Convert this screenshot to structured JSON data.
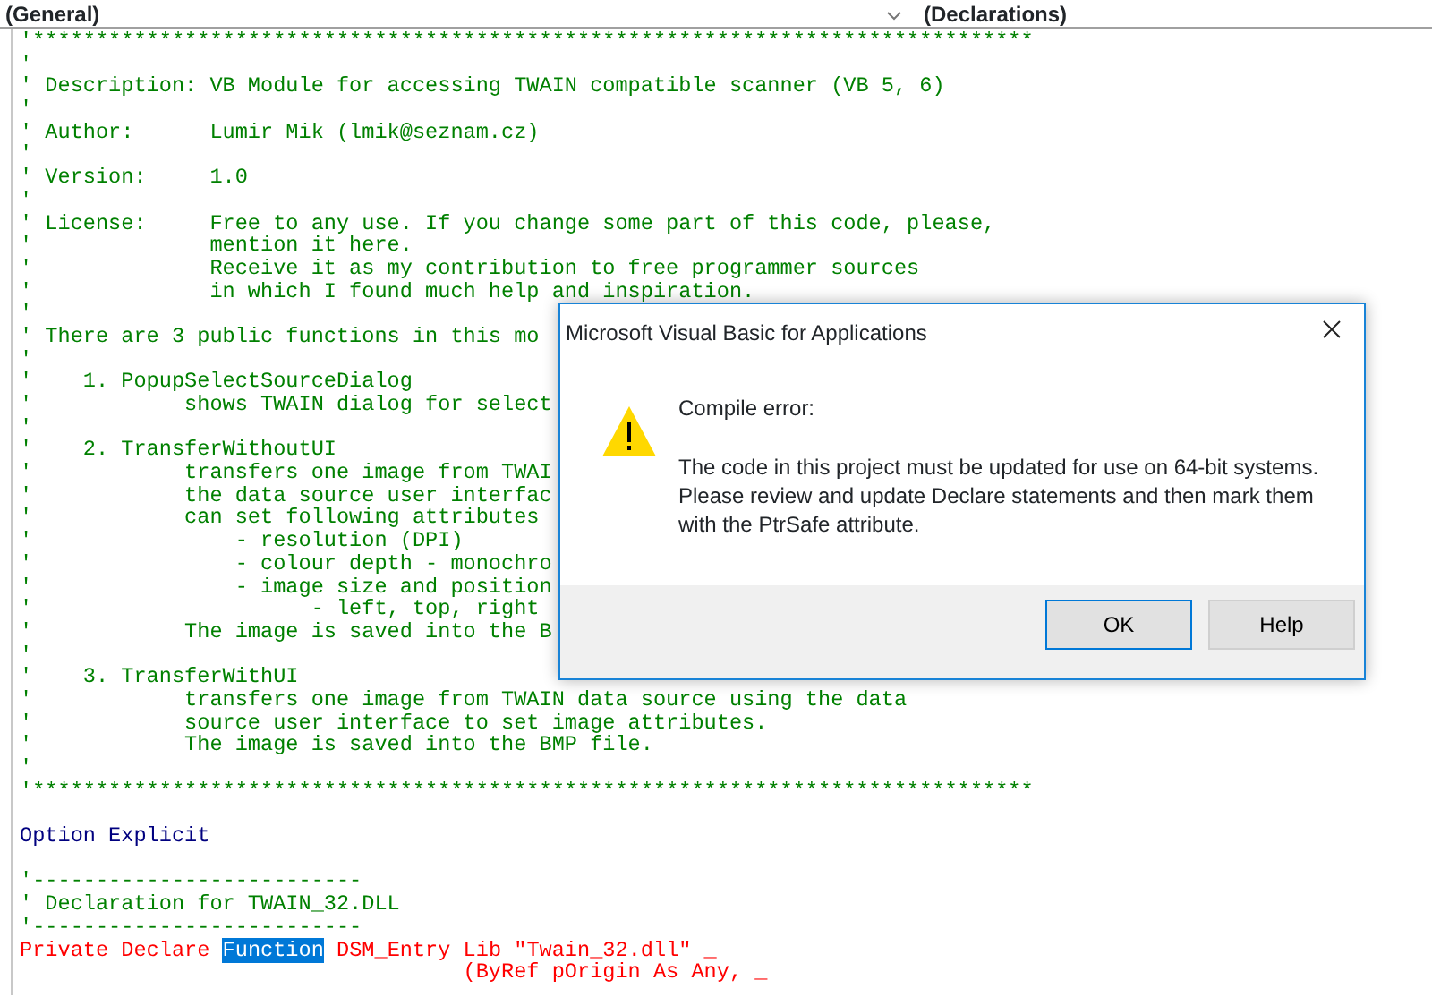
{
  "toolbar": {
    "object": "(General)",
    "procedure": "(Declarations)"
  },
  "lines": [
    {
      "kind": "comment",
      "text": "'*******************************************************************************"
    },
    {
      "kind": "comment",
      "text": "'"
    },
    {
      "kind": "comment",
      "text": "' Description: VB Module for accessing TWAIN compatible scanner (VB 5, 6)"
    },
    {
      "kind": "comment",
      "text": "'"
    },
    {
      "kind": "comment",
      "text": "' Author:      Lumir Mik (lmik@seznam.cz)"
    },
    {
      "kind": "comment",
      "text": "'"
    },
    {
      "kind": "comment",
      "text": "' Version:     1.0"
    },
    {
      "kind": "comment",
      "text": "'"
    },
    {
      "kind": "comment",
      "text": "' License:     Free to any use. If you change some part of this code, please,"
    },
    {
      "kind": "comment",
      "text": "'              mention it here."
    },
    {
      "kind": "comment",
      "text": "'              Receive it as my contribution to free programmer sources"
    },
    {
      "kind": "comment",
      "text": "'              in which I found much help and inspiration."
    },
    {
      "kind": "comment",
      "text": "'"
    },
    {
      "kind": "comment",
      "text": "' There are 3 public functions in this mo"
    },
    {
      "kind": "comment",
      "text": "'"
    },
    {
      "kind": "comment",
      "text": "'    1. PopupSelectSourceDialog"
    },
    {
      "kind": "comment",
      "text": "'            shows TWAIN dialog for select"
    },
    {
      "kind": "comment",
      "text": "'"
    },
    {
      "kind": "comment",
      "text": "'    2. TransferWithoutUI"
    },
    {
      "kind": "comment",
      "text": "'            transfers one image from TWAI"
    },
    {
      "kind": "comment",
      "text": "'            the data source user interfac"
    },
    {
      "kind": "comment",
      "text": "'            can set following attributes"
    },
    {
      "kind": "comment",
      "text": "'                - resolution (DPI)"
    },
    {
      "kind": "comment",
      "text": "'                - colour depth - monochro"
    },
    {
      "kind": "comment",
      "text": "'                - image size and position"
    },
    {
      "kind": "comment",
      "text": "'                      - left, top, right"
    },
    {
      "kind": "comment",
      "text": "'            The image is saved into the B"
    },
    {
      "kind": "comment",
      "text": "'"
    },
    {
      "kind": "comment",
      "text": "'    3. TransferWithUI"
    },
    {
      "kind": "comment",
      "text": "'            transfers one image from TWAIN data source using the data"
    },
    {
      "kind": "comment",
      "text": "'            source user interface to set image attributes."
    },
    {
      "kind": "comment",
      "text": "'            The image is saved into the BMP file."
    },
    {
      "kind": "comment",
      "text": "'"
    },
    {
      "kind": "comment",
      "text": "'*******************************************************************************"
    },
    {
      "kind": "blank"
    },
    {
      "kind": "keyword",
      "text": "Option Explicit"
    },
    {
      "kind": "blank"
    },
    {
      "kind": "comment",
      "text": "'--------------------------"
    },
    {
      "kind": "comment",
      "text": "' Declaration for TWAIN_32.DLL"
    },
    {
      "kind": "comment",
      "text": "'--------------------------"
    },
    {
      "kind": "error",
      "segments": [
        {
          "text": "Private Declare ",
          "selected": false
        },
        {
          "text": "Function",
          "selected": true
        },
        {
          "text": " DSM_Entry Lib \"Twain_32.dll\" _",
          "selected": false
        }
      ]
    },
    {
      "kind": "error",
      "text": "                                   (ByRef pOrigin As Any, _"
    }
  ],
  "dialog": {
    "title": "Microsoft Visual Basic for Applications",
    "heading": "Compile error:",
    "message": "The code in this project must be updated for use on 64-bit systems. Please review and update Declare statements and then mark them with the PtrSafe attribute.",
    "buttons": [
      {
        "label": "OK",
        "default": true
      },
      {
        "label": "Help",
        "default": false
      }
    ]
  }
}
